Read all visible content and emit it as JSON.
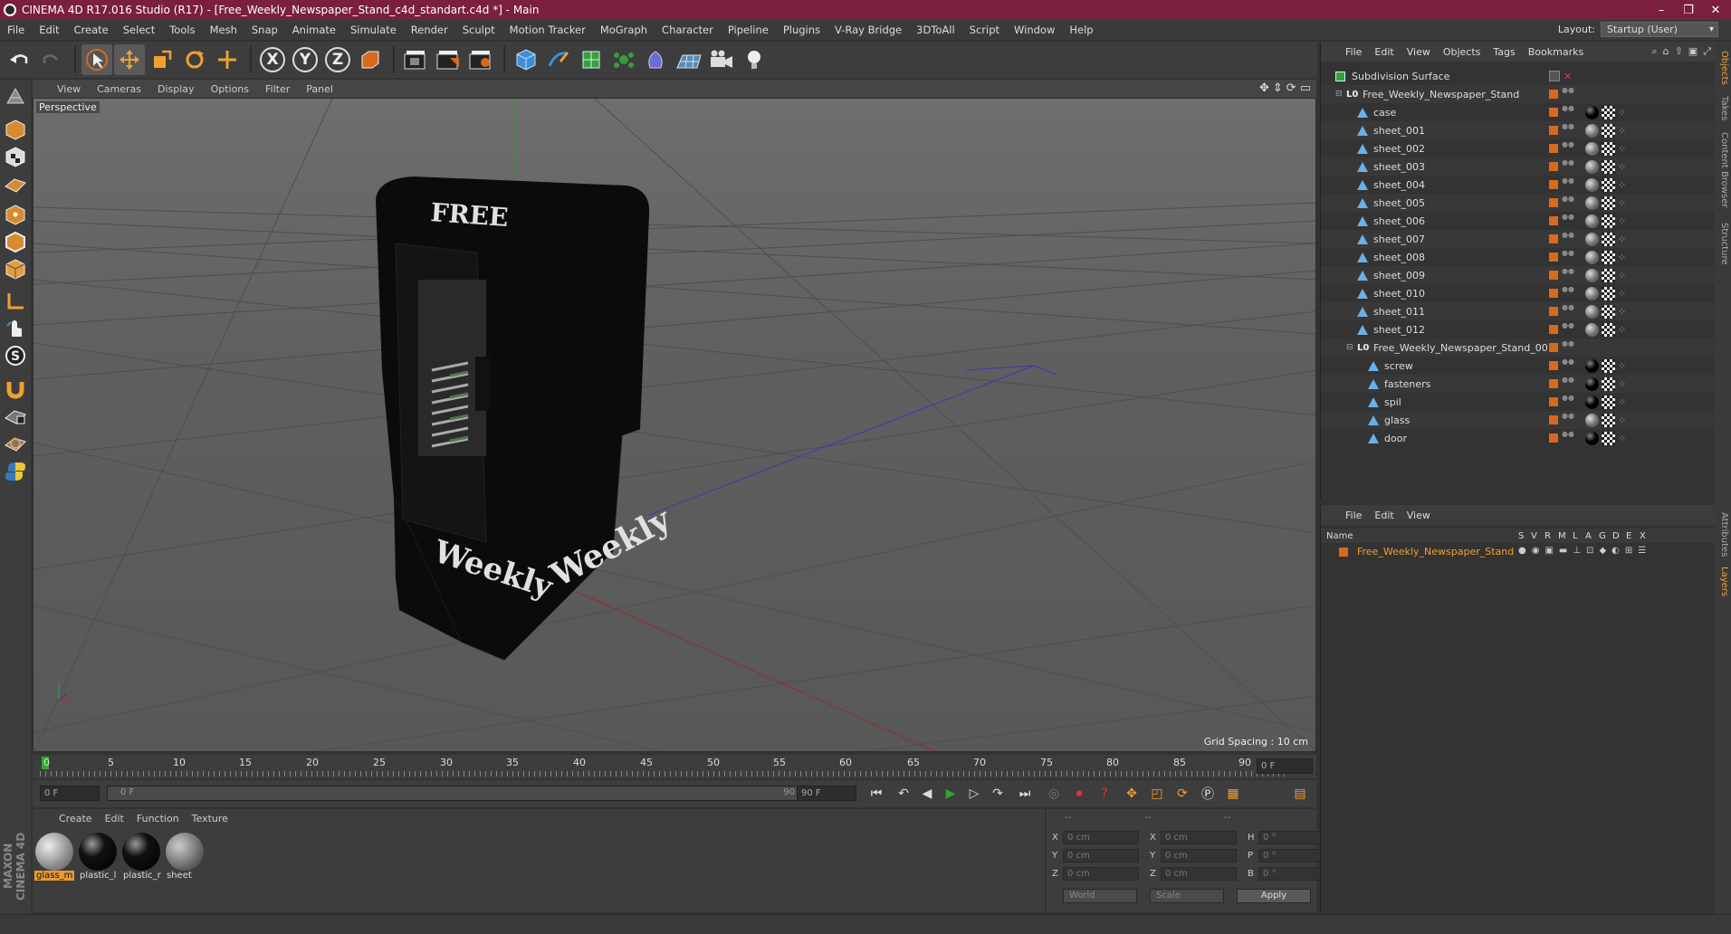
{
  "window": {
    "title": "CINEMA 4D R17.016 Studio (R17) - [Free_Weekly_Newspaper_Stand_c4d_standart.c4d *] - Main",
    "controls": [
      "–",
      "❐",
      "✕"
    ]
  },
  "menu": [
    "File",
    "Edit",
    "Create",
    "Select",
    "Tools",
    "Mesh",
    "Snap",
    "Animate",
    "Simulate",
    "Render",
    "Sculpt",
    "Motion Tracker",
    "MoGraph",
    "Character",
    "Pipeline",
    "Plugins",
    "V-Ray Bridge",
    "3DToAll",
    "Script",
    "Window",
    "Help"
  ],
  "layout": {
    "label": "Layout:",
    "value": "Startup (User)"
  },
  "toolbar": {
    "axes": [
      "X",
      "Y",
      "Z"
    ]
  },
  "viewport": {
    "menu": [
      "View",
      "Cameras",
      "Display",
      "Options",
      "Filter",
      "Panel"
    ],
    "label": "Perspective",
    "grid_spacing": "Grid Spacing : 10 cm",
    "model_text": {
      "top": "FREE",
      "side_left": "Weekly",
      "side_right": "Weekly"
    }
  },
  "timeline": {
    "ticks": [
      "0",
      "5",
      "10",
      "15",
      "20",
      "25",
      "30",
      "35",
      "40",
      "45",
      "50",
      "55",
      "60",
      "65",
      "70",
      "75",
      "80",
      "85",
      "90"
    ],
    "current_frame": "0 F",
    "start": "0 F",
    "slider_start": "0 F",
    "slider_end": "90 F",
    "end": "90 F"
  },
  "materials": {
    "menu": [
      "Create",
      "Edit",
      "Function",
      "Texture"
    ],
    "items": [
      {
        "name": "glass_m",
        "selected": true,
        "color": "#9a9a9a"
      },
      {
        "name": "plastic_l",
        "selected": false,
        "color": "#111111"
      },
      {
        "name": "plastic_r",
        "selected": false,
        "color": "#151515"
      },
      {
        "name": "sheet",
        "selected": false,
        "color": "#777777"
      }
    ]
  },
  "coordinates": {
    "headers": [
      "--",
      "--",
      "--"
    ],
    "rows": [
      {
        "l1": "X",
        "v1": "0 cm",
        "l2": "X",
        "v2": "0 cm",
        "l3": "H",
        "v3": "0 °"
      },
      {
        "l1": "Y",
        "v1": "0 cm",
        "l2": "Y",
        "v2": "0 cm",
        "l3": "P",
        "v3": "0 °"
      },
      {
        "l1": "Z",
        "v1": "0 cm",
        "l2": "Z",
        "v2": "0 cm",
        "l3": "B",
        "v3": "0 °"
      }
    ],
    "space": "World",
    "mode": "Scale",
    "apply": "Apply"
  },
  "objects": {
    "menu": [
      "File",
      "Edit",
      "View",
      "Objects",
      "Tags",
      "Bookmarks"
    ],
    "tree": [
      {
        "name": "Subdivision Surface",
        "indent": 0,
        "kind": "subd"
      },
      {
        "name": "Free_Weekly_Newspaper_Stand",
        "indent": 1,
        "kind": "null"
      },
      {
        "name": "case",
        "indent": 2,
        "kind": "poly",
        "tag": "black"
      },
      {
        "name": "sheet_001",
        "indent": 2,
        "kind": "poly",
        "tag": "grey"
      },
      {
        "name": "sheet_002",
        "indent": 2,
        "kind": "poly",
        "tag": "grey"
      },
      {
        "name": "sheet_003",
        "indent": 2,
        "kind": "poly",
        "tag": "grey"
      },
      {
        "name": "sheet_004",
        "indent": 2,
        "kind": "poly",
        "tag": "grey"
      },
      {
        "name": "sheet_005",
        "indent": 2,
        "kind": "poly",
        "tag": "grey"
      },
      {
        "name": "sheet_006",
        "indent": 2,
        "kind": "poly",
        "tag": "grey"
      },
      {
        "name": "sheet_007",
        "indent": 2,
        "kind": "poly",
        "tag": "grey"
      },
      {
        "name": "sheet_008",
        "indent": 2,
        "kind": "poly",
        "tag": "grey"
      },
      {
        "name": "sheet_009",
        "indent": 2,
        "kind": "poly",
        "tag": "grey"
      },
      {
        "name": "sheet_010",
        "indent": 2,
        "kind": "poly",
        "tag": "grey"
      },
      {
        "name": "sheet_011",
        "indent": 2,
        "kind": "poly",
        "tag": "grey"
      },
      {
        "name": "sheet_012",
        "indent": 2,
        "kind": "poly",
        "tag": "grey"
      },
      {
        "name": "Free_Weekly_Newspaper_Stand_001",
        "indent": 2,
        "kind": "null"
      },
      {
        "name": "screw",
        "indent": 3,
        "kind": "poly",
        "tag": "black"
      },
      {
        "name": "fasteners",
        "indent": 3,
        "kind": "poly",
        "tag": "black"
      },
      {
        "name": "spil",
        "indent": 3,
        "kind": "poly",
        "tag": "black"
      },
      {
        "name": "glass",
        "indent": 3,
        "kind": "poly",
        "tag": "grey"
      },
      {
        "name": "door",
        "indent": 3,
        "kind": "poly",
        "tag": "black"
      }
    ]
  },
  "layers": {
    "menu": [
      "File",
      "Edit",
      "View"
    ],
    "header": {
      "name": "Name",
      "flags": [
        "S",
        "V",
        "R",
        "M",
        "L",
        "A",
        "G",
        "D",
        "E",
        "X"
      ]
    },
    "rows": [
      {
        "name": "Free_Weekly_Newspaper_Stand"
      }
    ]
  },
  "right_tabs": [
    "Objects",
    "Takes",
    "Content Browser",
    "Structure",
    "Attributes",
    "Layers"
  ],
  "colors": {
    "title_bg": "#7a1f3d",
    "accent_orange": "#d86a1e",
    "viewport_bg": "#666666"
  }
}
